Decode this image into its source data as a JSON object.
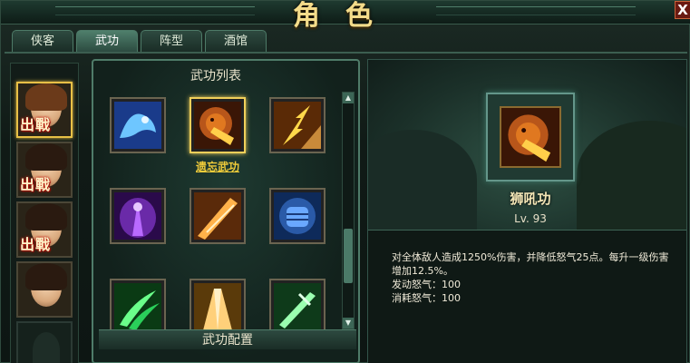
{
  "window": {
    "title": "角色",
    "close_label": "X"
  },
  "tabs": [
    {
      "label": "侠客",
      "active": false
    },
    {
      "label": "武功",
      "active": true
    },
    {
      "label": "阵型",
      "active": false
    },
    {
      "label": "酒馆",
      "active": false
    }
  ],
  "portraits": [
    {
      "name": "hero-1",
      "status": "出戰",
      "selected": true
    },
    {
      "name": "hero-2",
      "status": "出戰",
      "selected": false
    },
    {
      "name": "hero-3",
      "status": "出戰",
      "selected": false
    },
    {
      "name": "hero-4",
      "status": "",
      "selected": false
    },
    {
      "name": "empty-slot",
      "status": "",
      "selected": false
    }
  ],
  "skill_list": {
    "title": "武功列表",
    "selected_skill_label": "遗忘武功",
    "config_label": "武功配置",
    "skills": [
      {
        "icon": "frost-beast-icon",
        "colors": [
          "#1a3b8a",
          "#6ec6ff"
        ]
      },
      {
        "icon": "lion-roar-icon",
        "colors": [
          "#3a1606",
          "#e07820"
        ]
      },
      {
        "icon": "lightning-palm-icon",
        "colors": [
          "#5a2a06",
          "#ffd84a"
        ]
      },
      {
        "icon": "shadow-aura-icon",
        "colors": [
          "#2a0a4a",
          "#b96aff"
        ]
      },
      {
        "icon": "golden-strike-icon",
        "colors": [
          "#5a2a0a",
          "#ffb24a"
        ]
      },
      {
        "icon": "iron-fist-icon",
        "colors": [
          "#0e2a5a",
          "#6aa8ff"
        ]
      },
      {
        "icon": "bamboo-leaf-icon",
        "colors": [
          "#0a3a14",
          "#6aff8a"
        ]
      },
      {
        "icon": "sun-palm-icon",
        "colors": [
          "#5a3a0a",
          "#ffd07a"
        ]
      },
      {
        "icon": "jade-blade-icon",
        "colors": [
          "#0e3a1a",
          "#9affb0"
        ]
      }
    ]
  },
  "detail": {
    "icon": "lion-roar-icon",
    "name": "狮吼功",
    "level": "Lv. 93",
    "description_lines": [
      "对全体敌人造成1250%伤害，并降低怒气25点。每升一级伤害",
      "增加12.5%。",
      "发动怒气：100",
      "消耗怒气：100"
    ]
  }
}
